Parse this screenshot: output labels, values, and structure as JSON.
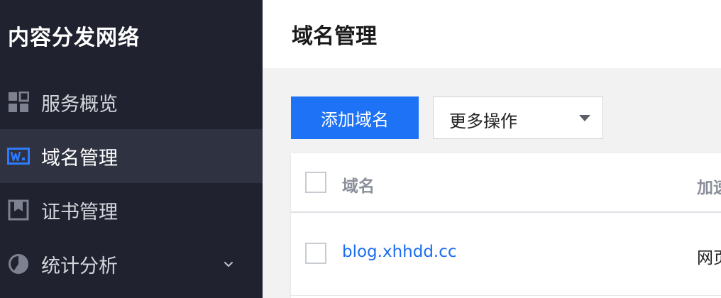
{
  "sidebar": {
    "brand": "内容分发网络",
    "items": [
      {
        "label": "服务概览",
        "icon": "dashboard-grid-icon",
        "active": false
      },
      {
        "label": "域名管理",
        "icon": "domain-w-icon",
        "active": true
      },
      {
        "label": "证书管理",
        "icon": "certificate-icon",
        "active": false
      },
      {
        "label": "统计分析",
        "icon": "pie-chart-icon",
        "active": false,
        "expandable": true
      }
    ]
  },
  "header": {
    "title": "域名管理"
  },
  "toolbar": {
    "add_label": "添加域名",
    "more_actions": {
      "selected": "更多操作"
    }
  },
  "table": {
    "columns": [
      "域名",
      "加速"
    ],
    "rows": [
      {
        "domain": "blog.xhhdd.cc",
        "type": "网页"
      }
    ]
  },
  "colors": {
    "sidebar_bg": "#202230",
    "sidebar_active": "#2f3240",
    "primary": "#1d72f5",
    "link": "#1d6df0"
  }
}
